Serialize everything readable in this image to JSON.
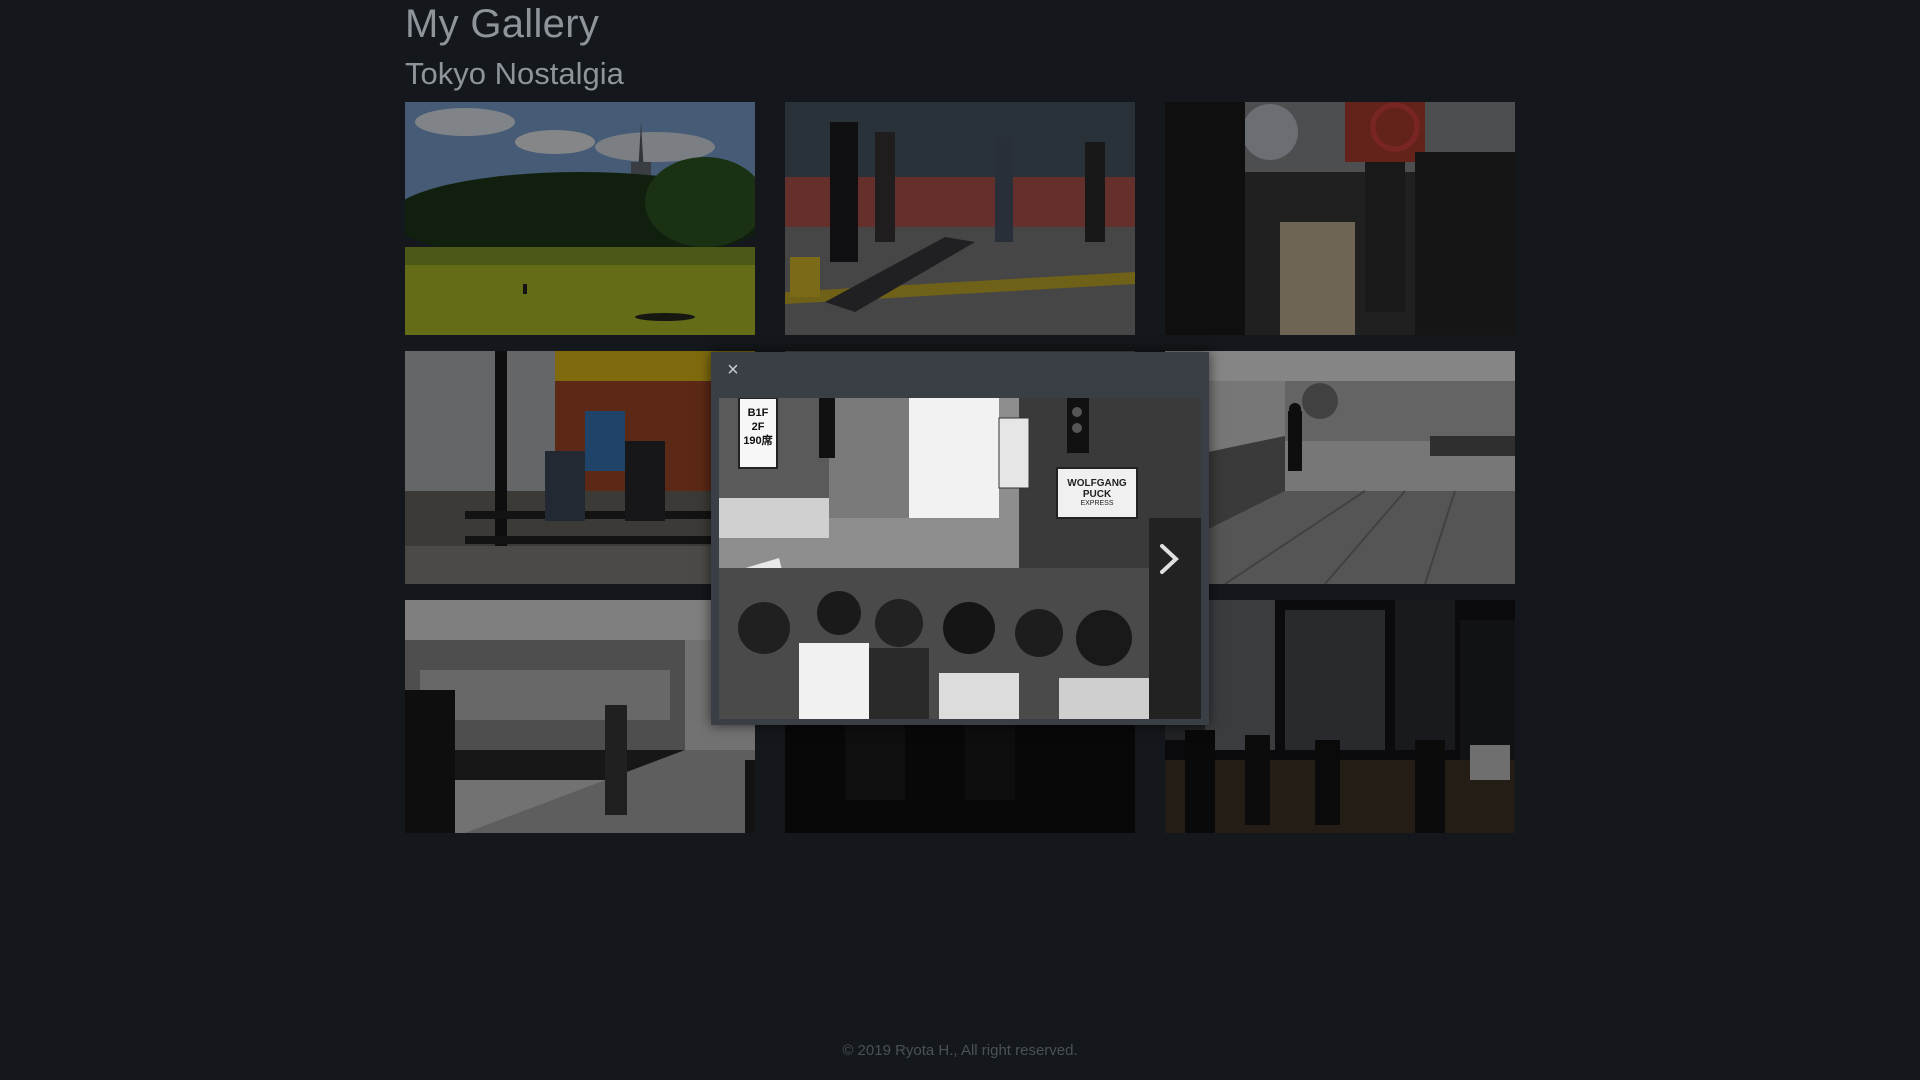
{
  "header": {
    "site_title": "My Gallery",
    "album_title": "Tokyo Nostalgia"
  },
  "gallery": {
    "photos": [
      {
        "subject": "park lawn with tower",
        "style": "color"
      },
      {
        "subject": "commuters crossing street",
        "style": "color"
      },
      {
        "subject": "crowd walking at night",
        "style": "color"
      },
      {
        "subject": "people sitting at storefront",
        "style": "color"
      },
      {
        "subject": "crowded shopping street",
        "style": "monochrome"
      },
      {
        "subject": "man walking on bridge",
        "style": "monochrome"
      },
      {
        "subject": "train platform",
        "style": "monochrome"
      },
      {
        "subject": "dark crowd",
        "style": "color"
      },
      {
        "subject": "city street at night",
        "style": "color"
      }
    ]
  },
  "lightbox": {
    "close_glyph": "×",
    "next_glyph": "›",
    "sign_floors": [
      "B1F",
      "2F",
      "190席"
    ],
    "sign_store": "WOLFGANG PUCK",
    "sign_store_sub": "EXPRESS"
  },
  "footer": {
    "copyright": "© 2019 Ryota H., All right reserved."
  },
  "colors": {
    "background": "#14171b",
    "title": "#8f949a",
    "lightbox_frame": "#3a3f46",
    "footer_text": "#4c5157"
  }
}
